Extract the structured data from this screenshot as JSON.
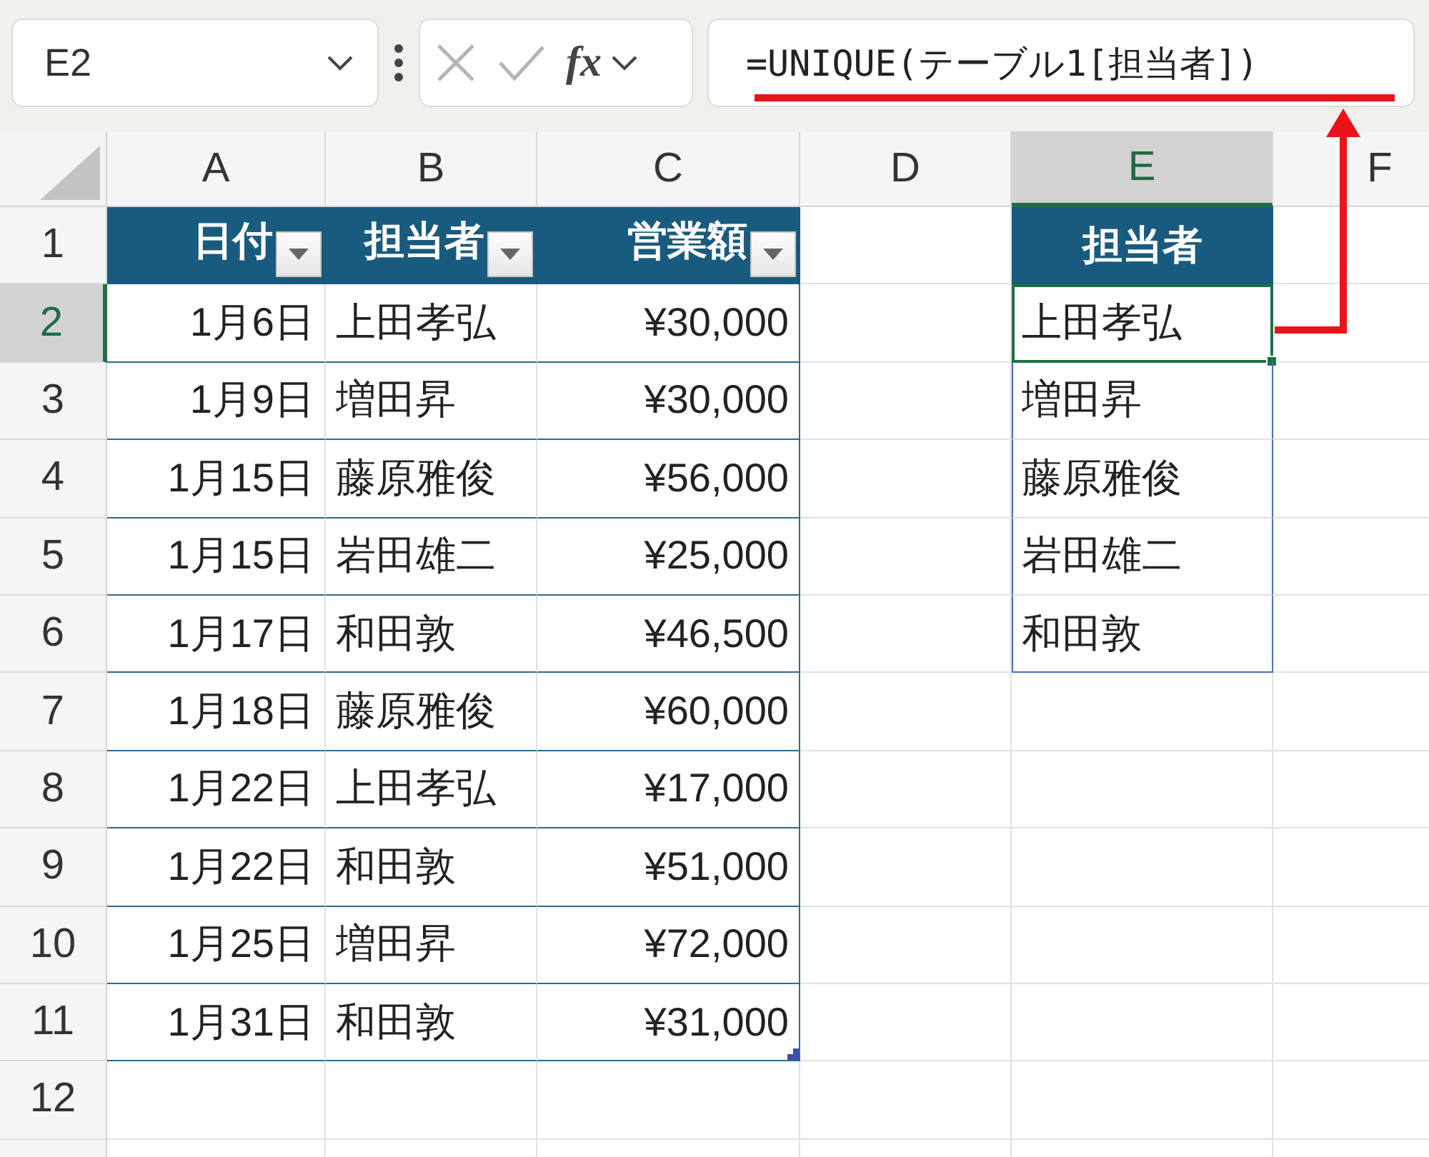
{
  "name_box": {
    "value": "E2"
  },
  "formula_bar": {
    "function_label": "fx",
    "value": "=UNIQUE(テーブル1[担当者])"
  },
  "columns": [
    {
      "label": "A",
      "selected": false
    },
    {
      "label": "B",
      "selected": false
    },
    {
      "label": "C",
      "selected": false
    },
    {
      "label": "D",
      "selected": false
    },
    {
      "label": "E",
      "selected": true
    },
    {
      "label": "F",
      "selected": false
    }
  ],
  "row_headers": [
    {
      "label": "1",
      "selected": false
    },
    {
      "label": "2",
      "selected": true
    },
    {
      "label": "3",
      "selected": false
    },
    {
      "label": "4",
      "selected": false
    },
    {
      "label": "5",
      "selected": false
    },
    {
      "label": "6",
      "selected": false
    },
    {
      "label": "7",
      "selected": false
    },
    {
      "label": "8",
      "selected": false
    },
    {
      "label": "9",
      "selected": false
    },
    {
      "label": "10",
      "selected": false
    },
    {
      "label": "11",
      "selected": false
    },
    {
      "label": "12",
      "selected": false
    }
  ],
  "table": {
    "headers": [
      "日付",
      "担当者",
      "営業額"
    ],
    "rows": [
      [
        "1月6日",
        "上田孝弘",
        "¥30,000"
      ],
      [
        "1月9日",
        "増田昇",
        "¥30,000"
      ],
      [
        "1月15日",
        "藤原雅俊",
        "¥56,000"
      ],
      [
        "1月15日",
        "岩田雄二",
        "¥25,000"
      ],
      [
        "1月17日",
        "和田敦",
        "¥46,500"
      ],
      [
        "1月18日",
        "藤原雅俊",
        "¥60,000"
      ],
      [
        "1月22日",
        "上田孝弘",
        "¥17,000"
      ],
      [
        "1月22日",
        "和田敦",
        "¥51,000"
      ],
      [
        "1月25日",
        "増田昇",
        "¥72,000"
      ],
      [
        "1月31日",
        "和田敦",
        "¥31,000"
      ]
    ]
  },
  "spill": {
    "header": "担当者",
    "values": [
      {
        "text": "上田孝弘",
        "selected": true
      },
      {
        "text": "増田昇",
        "selected": false
      },
      {
        "text": "藤原雅俊",
        "selected": false
      },
      {
        "text": "岩田雄二",
        "selected": false
      },
      {
        "text": "和田敦",
        "selected": false
      }
    ]
  }
}
